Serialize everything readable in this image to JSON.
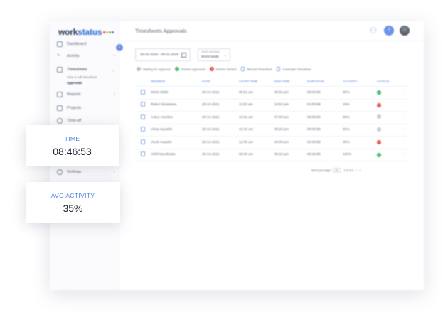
{
  "app": {
    "logo_main": "work",
    "logo_accent": "status",
    "logo_dot_colors": [
      "#e8493f",
      "#f2a93b",
      "#3fb55e",
      "#3b79e0"
    ],
    "accent_color": "#4f86e0"
  },
  "sidebar": {
    "items": [
      {
        "label": "Dashboard",
        "icon": "dashboard-icon"
      },
      {
        "label": "Activity",
        "icon": "activity-icon"
      },
      {
        "label": "Timesheets",
        "icon": "timesheets-icon"
      },
      {
        "label": "Reports",
        "icon": "reports-icon"
      },
      {
        "label": "Projects",
        "icon": "projects-icon"
      },
      {
        "label": "Time-off",
        "icon": "time-off-icon"
      },
      {
        "label": "Settings",
        "icon": "settings-icon"
      }
    ],
    "subitems": [
      {
        "label": "View & edit timesheet"
      },
      {
        "label": "Approvals"
      }
    ]
  },
  "header": {
    "title": "Timesheets Approvals"
  },
  "filters": {
    "date_range": "30-02-2020 - 09-02-2020",
    "member_caption": "Select members",
    "member_value": "Mohit Malik"
  },
  "legend": [
    {
      "label": "Waiting for Approval",
      "color": "#b8bec8"
    },
    {
      "label": "Entries Approved",
      "color": "#3fb55e"
    },
    {
      "label": "Entries Denied",
      "color": "#e8493f"
    },
    {
      "label": "Manual Timesheet",
      "color": "#7fa6e6"
    },
    {
      "label": "Automatic Timesheet",
      "color": "#7fa6e6"
    }
  ],
  "table": {
    "columns": [
      "MEMBER",
      "DATE",
      "START TIME",
      "END TIME",
      "DURATION",
      "ACTIVITY",
      "STATUS"
    ],
    "rows": [
      {
        "member": "Mohit Malik",
        "date": "20-10-2021",
        "start": "09:51 am",
        "end": "05:52 pm",
        "duration": "08:00:88",
        "activity": "90%",
        "status": "approved"
      },
      {
        "member": "Rahul Srivastava",
        "date": "20-10-2021",
        "start": "11:52 am",
        "end": "10:52 pm",
        "duration": "01:00:88",
        "activity": "10%",
        "status": "denied"
      },
      {
        "member": "Ankur Hombre",
        "date": "20-10-2021",
        "start": "10:02 am",
        "end": "07:00 pm",
        "duration": "08:58:88",
        "activity": "99%",
        "status": "waiting"
      },
      {
        "member": "Vikas Kaushik",
        "date": "20-10-2021",
        "start": "10:15 am",
        "end": "06:20 pm",
        "duration": "08:05:88",
        "activity": "92%",
        "status": "waiting"
      },
      {
        "member": "Vivek Awasthi",
        "date": "20-10-2021",
        "start": "12:00 am",
        "end": "04:00 pm",
        "duration": "04:00:88",
        "activity": "45%",
        "status": "denied"
      },
      {
        "member": "Akhil Mandiratta",
        "date": "20-10-2021",
        "start": "09:00 am",
        "end": "06:15 pm",
        "duration": "09:15:88",
        "activity": "100%",
        "status": "approved"
      }
    ]
  },
  "pagination": {
    "per_page_label": "items per page",
    "per_page": "10",
    "range": "1-6 of 6"
  },
  "cards": {
    "time_label": "TIME",
    "time_value": "08:46:53",
    "activity_label": "AVG ACTIVITY",
    "activity_value": "35%"
  }
}
